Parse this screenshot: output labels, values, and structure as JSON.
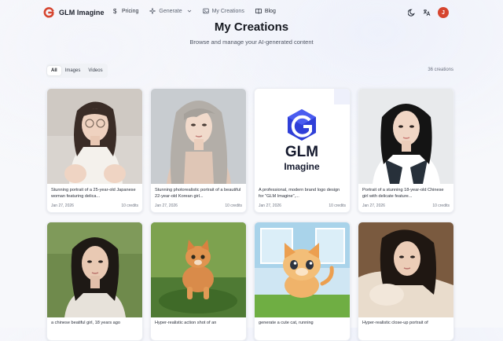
{
  "brand": {
    "name": "GLM Imagine",
    "mark_color": "#d6452f"
  },
  "nav": {
    "links": [
      {
        "label": "Pricing",
        "icon": "dollar-icon"
      },
      {
        "label": "Generate",
        "icon": "sparkle-icon"
      },
      {
        "label": "My Creations",
        "icon": "image-icon"
      },
      {
        "label": "Blog",
        "icon": "book-icon"
      }
    ],
    "avatar_initial": "J"
  },
  "page": {
    "title": "My Creations",
    "subtitle": "Browse and manage your AI-generated content",
    "creations_count": "36 creations"
  },
  "filters": [
    {
      "label": "All",
      "active": true
    },
    {
      "label": "Images",
      "active": false
    },
    {
      "label": "Videos",
      "active": false
    }
  ],
  "creations": [
    {
      "caption": "Stunning portrait of a 25-year-old Japanese woman featuring delica...",
      "date": "Jan 27, 2026",
      "credits": "10 credits",
      "thumb": "portrait-glasses-woman"
    },
    {
      "caption": "Stunning photorealistic portrait of a beautiful 22-year-old Korean girl...",
      "date": "Jan 27, 2026",
      "credits": "10 credits",
      "thumb": "portrait-long-hair-woman"
    },
    {
      "caption": "A professional, modern brand logo design for \"GLM Imagine\",...",
      "date": "Jan 27, 2026",
      "credits": "10 credits",
      "thumb": "glm-imagine-logo",
      "logo_text_1": "GLM",
      "logo_text_2": "Imagine"
    },
    {
      "caption": "Portrait of a stunning 18-year-old Chinese girl with delicate feature...",
      "date": "Jan 27, 2026",
      "credits": "10 credits",
      "thumb": "portrait-student-girl"
    },
    {
      "caption": "a chinese beatiful girl, 18 years ago",
      "thumb": "portrait-girl-field"
    },
    {
      "caption": "Hyper-realistic action shot of an",
      "thumb": "kitten-running-grass"
    },
    {
      "caption": "generate a cute cat, running",
      "thumb": "cartoon-cat-running"
    },
    {
      "caption": "Hyper-realistic close-up portrait of",
      "thumb": "portrait-woman-pillow"
    }
  ]
}
